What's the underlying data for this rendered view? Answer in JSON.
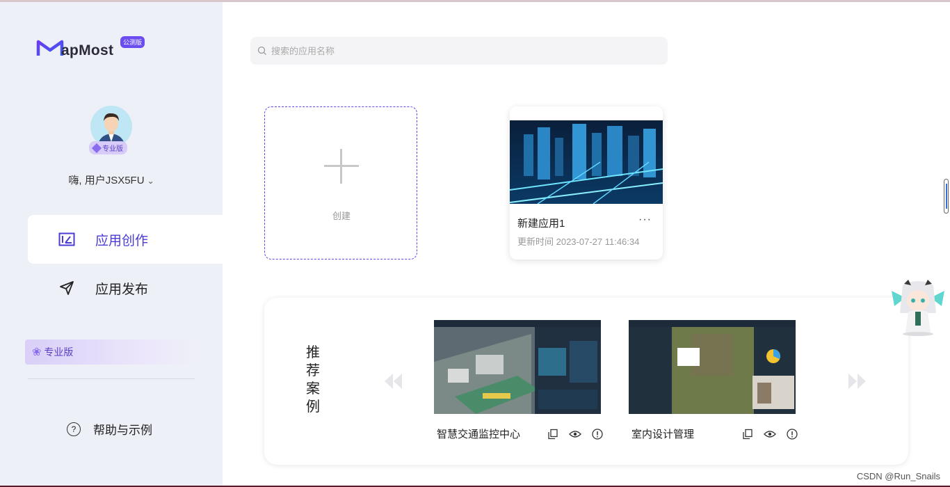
{
  "brand": {
    "name": "apMost",
    "badge": "公测版",
    "colors": {
      "accent": "#4a3bd6",
      "badge": "#6b4cf0"
    }
  },
  "user": {
    "greeting": "嗨, 用户JSX5FU",
    "tier": "专业版"
  },
  "nav": [
    {
      "label": "应用创作",
      "icon": "edit-board-icon",
      "active": true
    },
    {
      "label": "应用发布",
      "icon": "send-icon",
      "active": false
    }
  ],
  "pro_banner": {
    "label": "专业版"
  },
  "help": {
    "label": "帮助与示例"
  },
  "search": {
    "placeholder": "搜索的应用名称"
  },
  "create": {
    "label": "创建"
  },
  "apps": [
    {
      "title": "新建应用1",
      "updated": "更新时间 2023-07-27 11:46:34",
      "more": "···"
    }
  ],
  "recommend": {
    "title": "推荐案例",
    "cases": [
      {
        "name": "智慧交通监控中心"
      },
      {
        "name": "室内设计管理"
      }
    ]
  },
  "watermark": "CSDN @Run_Snails"
}
